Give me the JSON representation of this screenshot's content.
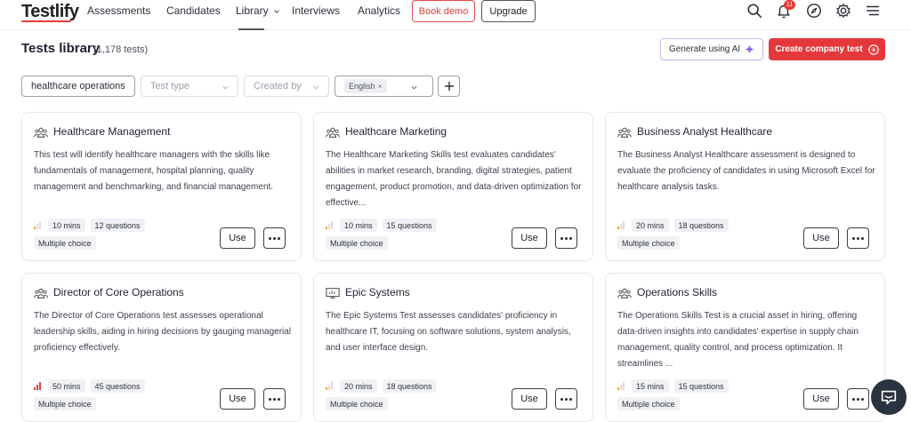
{
  "brand": {
    "name": "Testlify"
  },
  "nav": {
    "assessments": "Assessments",
    "candidates": "Candidates",
    "library": "Library",
    "interviews": "Interviews",
    "analytics": "Analytics",
    "book_demo": "Book demo",
    "upgrade": "Upgrade",
    "notification_count": "11"
  },
  "header": {
    "title": "Tests library",
    "count": "(1,178 tests)",
    "ai_button": "Generate using AI",
    "create_button": "Create company test"
  },
  "filters": {
    "search_value": "healthcare operations",
    "test_type_placeholder": "Test type",
    "created_by_placeholder": "Created by",
    "language_chip": "English"
  },
  "colors": {
    "accent": "#e5383b",
    "level_low": "#f5a623",
    "level_high": "#e23b3b"
  },
  "cards": [
    {
      "title": "Healthcare Management",
      "icon": "team-icon",
      "description": "This test will identify healthcare managers with the skills like fundamentals of management, hospital planning, quality management and benchmarking, and financial management.",
      "duration": "10 mins",
      "questions": "12 questions",
      "type": "Multiple choice",
      "level": 1,
      "use": "Use"
    },
    {
      "title": "Healthcare Marketing",
      "icon": "team-icon",
      "description": "The Healthcare Marketing Skills test evaluates candidates' abilities in market research, branding, digital strategies, patient engagement, product promotion, and data-driven optimization for effective...",
      "duration": "10 mins",
      "questions": "15 questions",
      "type": "Multiple choice",
      "level": 1,
      "use": "Use"
    },
    {
      "title": "Business Analyst Healthcare",
      "icon": "team-icon",
      "description": "The Business Analyst Healthcare assessment is designed to evaluate the proficiency of candidates in using Microsoft Excel for healthcare analysis tasks.",
      "duration": "20 mins",
      "questions": "18 questions",
      "type": "Multiple choice",
      "level": 1,
      "use": "Use"
    },
    {
      "title": "Director of Core Operations",
      "icon": "team-icon",
      "description": "The Director of Core Operations test assesses operational leadership skills, aiding in hiring decisions by gauging managerial proficiency effectively.",
      "duration": "50 mins",
      "questions": "45 questions",
      "type": "Multiple choice",
      "level": 3,
      "use": "Use"
    },
    {
      "title": "Epic Systems",
      "icon": "presentation-icon",
      "description": "The Epic Systems Test assesses candidates' proficiency in healthcare IT, focusing on software solutions, system analysis, and user interface design.",
      "duration": "20 mins",
      "questions": "18 questions",
      "type": "Multiple choice",
      "level": 1,
      "use": "Use"
    },
    {
      "title": "Operations Skills",
      "icon": "team-icon",
      "description": "The Operations Skills Test is a crucial asset in hiring, offering data-driven insights into candidates' expertise in supply chain management, quality control, and process optimization. It streamlines ...",
      "duration": "15 mins",
      "questions": "15 questions",
      "type": "Multiple choice",
      "level": 1,
      "use": "Use"
    }
  ]
}
